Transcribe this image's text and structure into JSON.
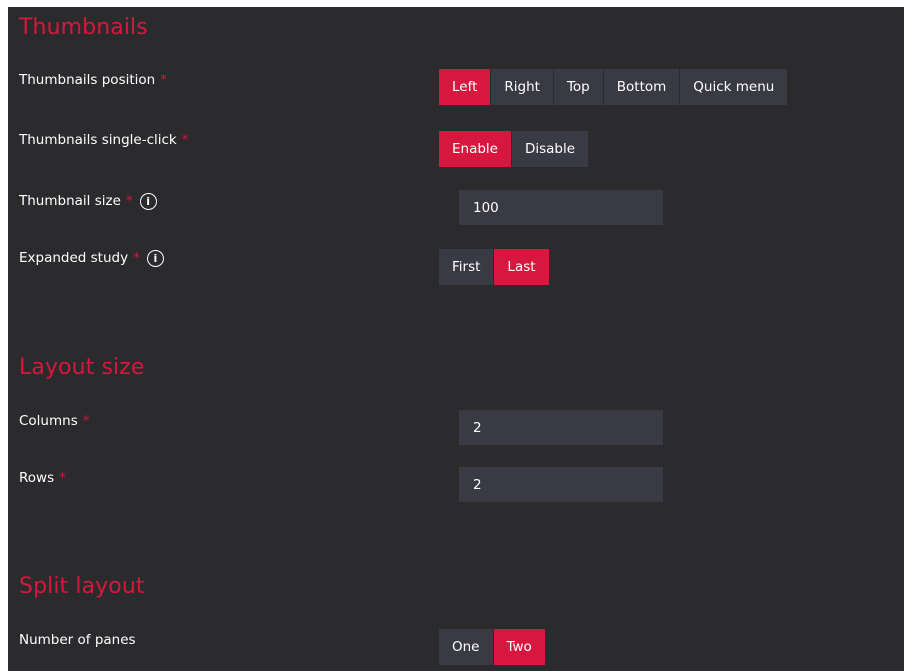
{
  "thumbnails": {
    "title": "Thumbnails",
    "position": {
      "label": "Thumbnails position",
      "required_mark": "*",
      "options": [
        "Left",
        "Right",
        "Top",
        "Bottom",
        "Quick menu"
      ],
      "selected": "Left"
    },
    "single_click": {
      "label": "Thumbnails single-click",
      "required_mark": "*",
      "options": [
        "Enable",
        "Disable"
      ],
      "selected": "Enable"
    },
    "size": {
      "label": "Thumbnail size",
      "required_mark": "*",
      "info_icon": "info-icon",
      "info_glyph": "i",
      "value": "100"
    },
    "expanded_study": {
      "label": "Expanded study",
      "required_mark": "*",
      "info_icon": "info-icon",
      "info_glyph": "i",
      "options": [
        "First",
        "Last"
      ],
      "selected": "Last"
    }
  },
  "layout_size": {
    "title": "Layout size",
    "columns": {
      "label": "Columns",
      "required_mark": "*",
      "value": "2"
    },
    "rows": {
      "label": "Rows",
      "required_mark": "*",
      "value": "2"
    }
  },
  "split_layout": {
    "title": "Split layout",
    "panes": {
      "label": "Number of panes",
      "options": [
        "One",
        "Two"
      ],
      "selected": "Two"
    }
  },
  "colors": {
    "background": "#2b2a2d",
    "accent": "#d7173d",
    "control": "#393a44",
    "text": "#ffffff"
  }
}
